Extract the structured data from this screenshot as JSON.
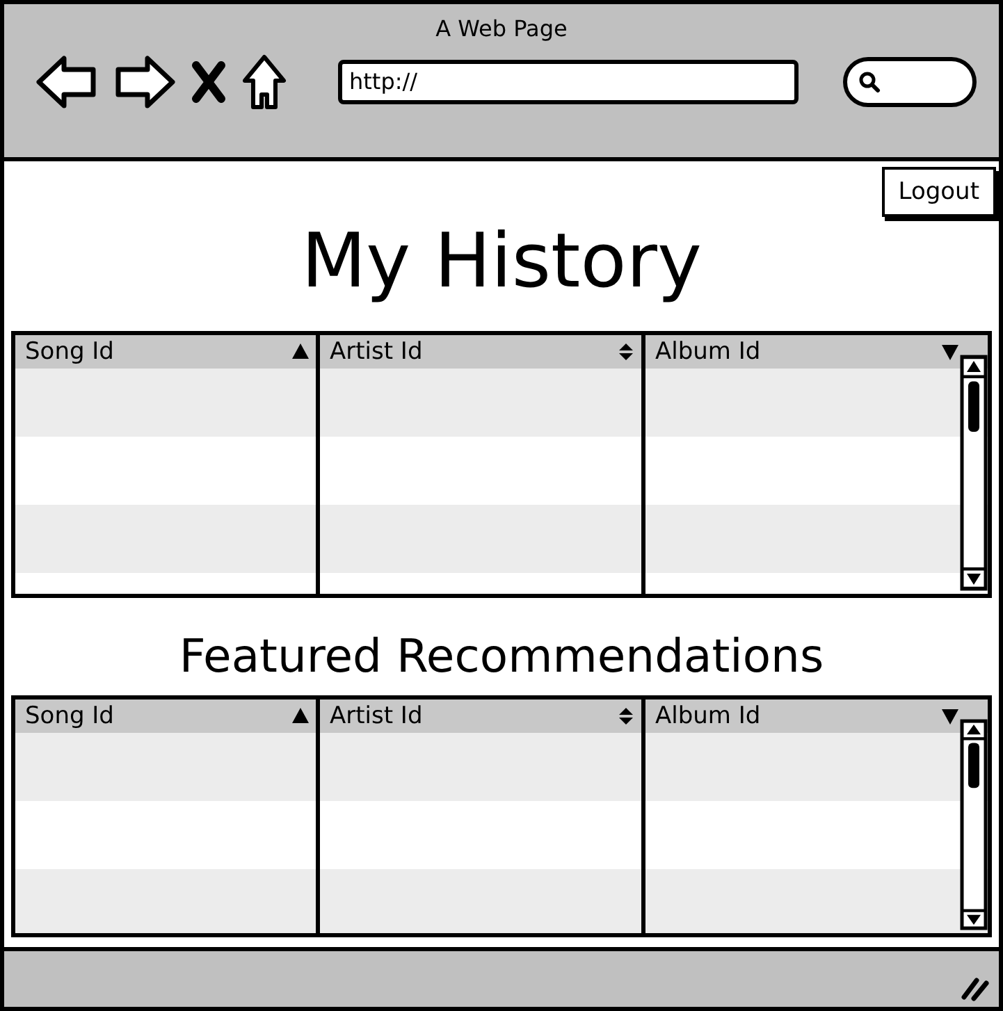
{
  "window": {
    "title": "A Web Page"
  },
  "toolbar": {
    "address": "http://"
  },
  "logout_button": "Logout",
  "history": {
    "heading": "My History",
    "columns": [
      {
        "label": "Song Id",
        "sorted": true,
        "descending": false
      },
      {
        "label": "Artist Id",
        "sorted": false,
        "descending": false
      },
      {
        "label": "Album Id",
        "sorted": true,
        "descending": true
      }
    ]
  },
  "recommendations": {
    "heading": "Featured Recommendations",
    "columns": [
      {
        "label": "Song Id",
        "sorted": true,
        "descending": false
      },
      {
        "label": "Artist Id",
        "sorted": false,
        "descending": false
      },
      {
        "label": "Album Id",
        "sorted": true,
        "descending": true
      }
    ]
  }
}
